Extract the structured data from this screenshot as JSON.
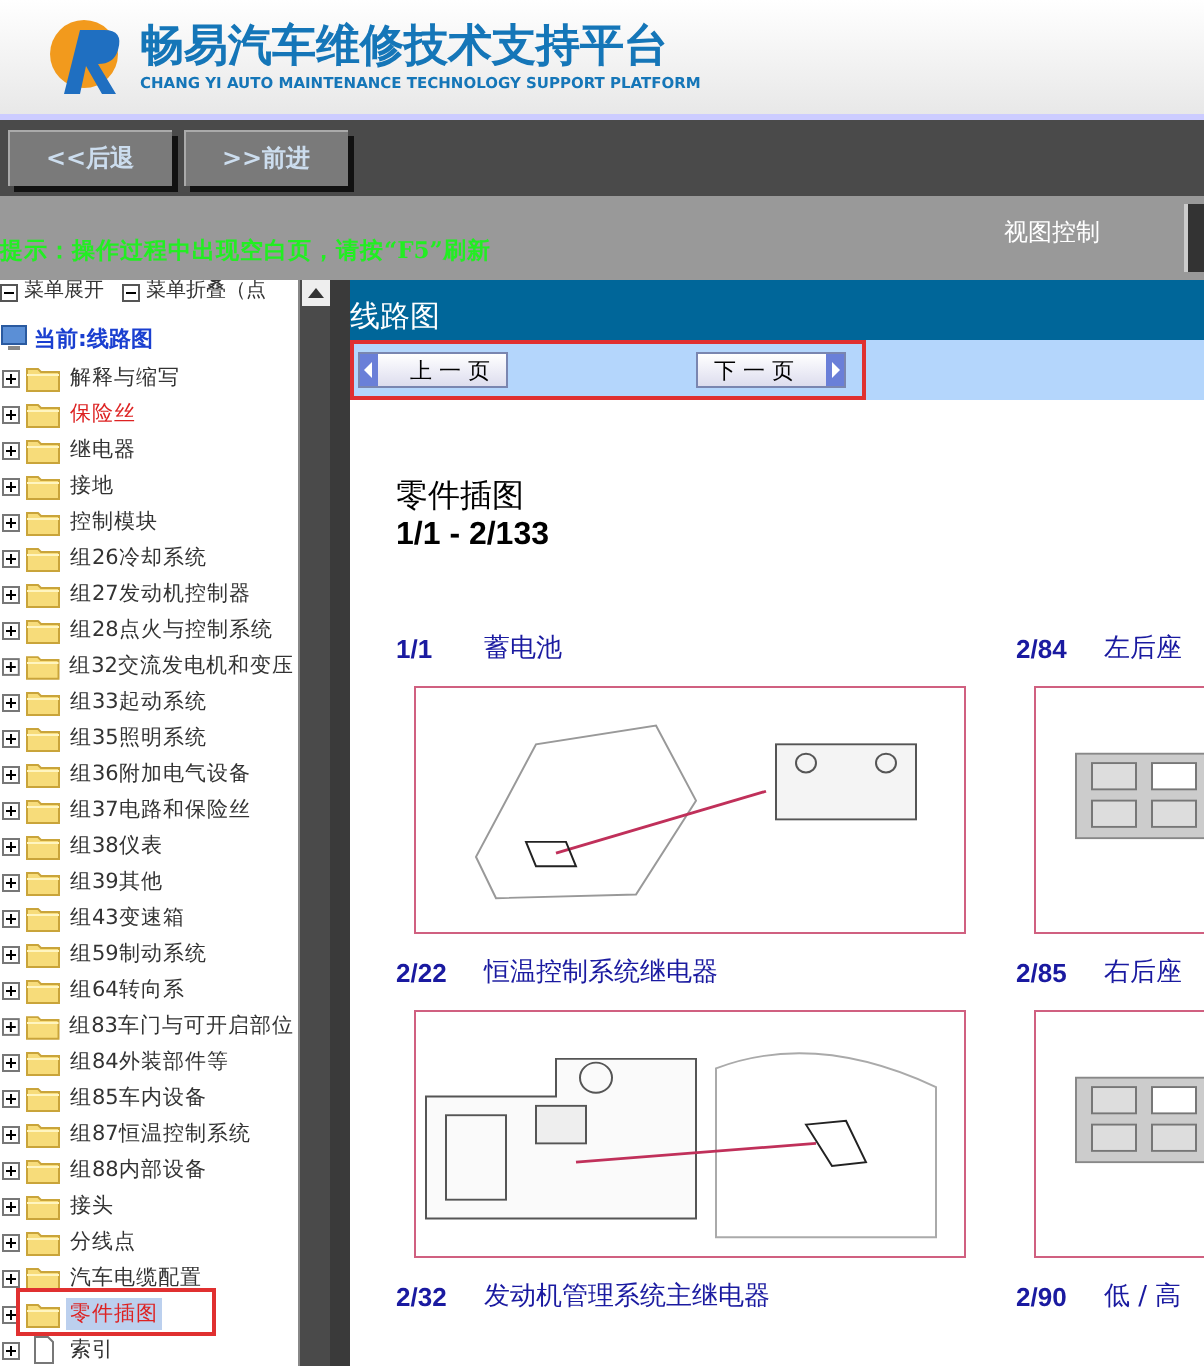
{
  "header": {
    "title": "畅易汽车维修技术支持平台",
    "subtitle": "CHANG YI AUTO MAINTENANCE TECHNOLOGY SUPPORT PLATFORM"
  },
  "nav_buttons": [
    "<<后退",
    ">>前进"
  ],
  "hint": "提示：操作过程中出现空白页，请按“F5”刷新",
  "view_control": "视图控制",
  "sidebar": {
    "toolbar": [
      "菜单展开",
      "菜单折叠（点"
    ],
    "root": "当前:线路图",
    "items": [
      {
        "label": "解释与缩写",
        "kind": "folder",
        "emphasis": false,
        "selected": false,
        "annotated": false
      },
      {
        "label": "保险丝",
        "kind": "folder",
        "emphasis": true,
        "selected": false,
        "annotated": false
      },
      {
        "label": "继电器",
        "kind": "folder",
        "emphasis": false,
        "selected": false,
        "annotated": false
      },
      {
        "label": "接地",
        "kind": "folder",
        "emphasis": false,
        "selected": false,
        "annotated": false
      },
      {
        "label": "控制模块",
        "kind": "folder",
        "emphasis": false,
        "selected": false,
        "annotated": false
      },
      {
        "label": "组26冷却系统",
        "kind": "folder",
        "emphasis": false,
        "selected": false,
        "annotated": false
      },
      {
        "label": "组27发动机控制器",
        "kind": "folder",
        "emphasis": false,
        "selected": false,
        "annotated": false
      },
      {
        "label": "组28点火与控制系统",
        "kind": "folder",
        "emphasis": false,
        "selected": false,
        "annotated": false
      },
      {
        "label": "组32交流发电机和变压",
        "kind": "folder",
        "emphasis": false,
        "selected": false,
        "annotated": false
      },
      {
        "label": "组33起动系统",
        "kind": "folder",
        "emphasis": false,
        "selected": false,
        "annotated": false
      },
      {
        "label": "组35照明系统",
        "kind": "folder",
        "emphasis": false,
        "selected": false,
        "annotated": false
      },
      {
        "label": "组36附加电气设备",
        "kind": "folder",
        "emphasis": false,
        "selected": false,
        "annotated": false
      },
      {
        "label": "组37电路和保险丝",
        "kind": "folder",
        "emphasis": false,
        "selected": false,
        "annotated": false
      },
      {
        "label": "组38仪表",
        "kind": "folder",
        "emphasis": false,
        "selected": false,
        "annotated": false
      },
      {
        "label": "组39其他",
        "kind": "folder",
        "emphasis": false,
        "selected": false,
        "annotated": false
      },
      {
        "label": "组43变速箱",
        "kind": "folder",
        "emphasis": false,
        "selected": false,
        "annotated": false
      },
      {
        "label": "组59制动系统",
        "kind": "folder",
        "emphasis": false,
        "selected": false,
        "annotated": false
      },
      {
        "label": "组64转向系",
        "kind": "folder",
        "emphasis": false,
        "selected": false,
        "annotated": false
      },
      {
        "label": "组83车门与可开启部位",
        "kind": "folder",
        "emphasis": false,
        "selected": false,
        "annotated": false
      },
      {
        "label": "组84外装部件等",
        "kind": "folder",
        "emphasis": false,
        "selected": false,
        "annotated": false
      },
      {
        "label": "组85车内设备",
        "kind": "folder",
        "emphasis": false,
        "selected": false,
        "annotated": false
      },
      {
        "label": "组87恒温控制系统",
        "kind": "folder",
        "emphasis": false,
        "selected": false,
        "annotated": false
      },
      {
        "label": "组88内部设备",
        "kind": "folder",
        "emphasis": false,
        "selected": false,
        "annotated": false
      },
      {
        "label": "接头",
        "kind": "folder",
        "emphasis": false,
        "selected": false,
        "annotated": false
      },
      {
        "label": "分线点",
        "kind": "folder",
        "emphasis": false,
        "selected": false,
        "annotated": false
      },
      {
        "label": "汽车电缆配置",
        "kind": "folder",
        "emphasis": false,
        "selected": false,
        "annotated": false
      },
      {
        "label": "零件插图",
        "kind": "folder",
        "emphasis": true,
        "selected": true,
        "annotated": true
      },
      {
        "label": "索引",
        "kind": "document",
        "emphasis": false,
        "selected": false,
        "annotated": false
      }
    ]
  },
  "content": {
    "title": "线路图",
    "pager": {
      "prev": "上 一 页",
      "next": "下 一 页",
      "annotated": true
    },
    "heading": "零件插图",
    "range": "1/1 - 2/133",
    "cards": [
      {
        "code": "1/1",
        "name": "蓄电池",
        "kind": "battery"
      },
      {
        "code": "2/84",
        "name": "左后座",
        "kind": "relay-box"
      },
      {
        "code": "2/22",
        "name": "恒温控制系统继电器",
        "kind": "engine-bay"
      },
      {
        "code": "2/85",
        "name": "右后座",
        "kind": "relay-box"
      },
      {
        "code": "2/32",
        "name": "发动机管理系统主继电器",
        "kind": "none"
      },
      {
        "code": "2/90",
        "name": "低 / 高",
        "kind": "none"
      }
    ]
  }
}
